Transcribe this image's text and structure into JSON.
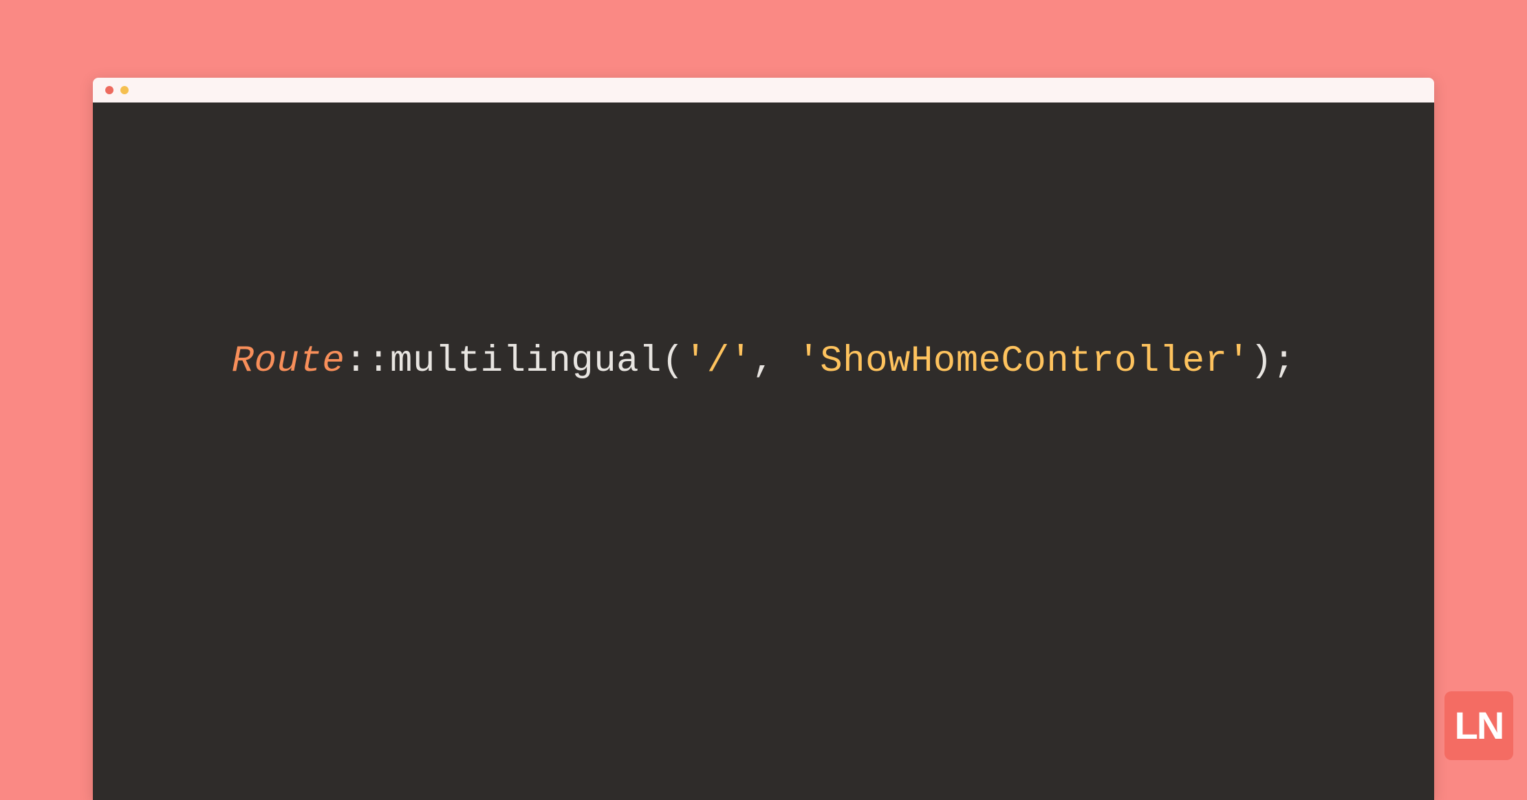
{
  "code": {
    "class": "Route",
    "scope": "::",
    "method": "multilingual",
    "paren_open": "(",
    "arg1": "'/'",
    "comma": ", ",
    "arg2": "'ShowHomeController'",
    "paren_close": ")",
    "semicolon": ";"
  },
  "logo": {
    "text": "LN"
  },
  "colors": {
    "background": "#fa8984",
    "titlebar": "#fdf4f3",
    "editor_bg": "#2f2c2a",
    "class_color": "#f88f5a",
    "text_color": "#e8e5e1",
    "string_color": "#fec35e",
    "logo_bg": "#f46c63"
  }
}
